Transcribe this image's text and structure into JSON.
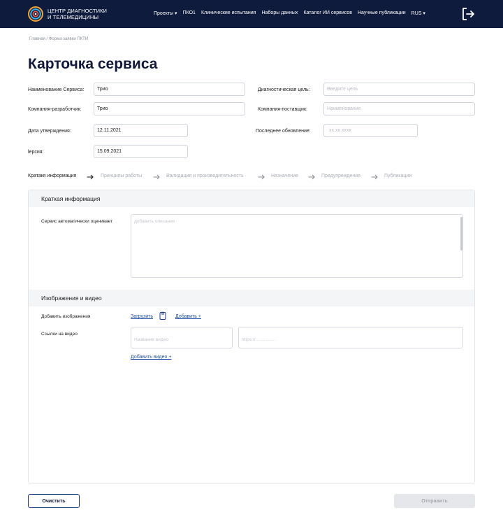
{
  "header": {
    "brand_line1": "ЦЕНТР ДИАГНОСТИКИ",
    "brand_line2": "И ТЕЛЕМЕДИЦИНЫ",
    "nav": [
      "Проекты ▾",
      "ПКО1",
      "Клинические испытания",
      "Наборы данных",
      "Каталог ИИ сервисов",
      "Научные публикации",
      "RUS ▾"
    ],
    "logo_icon": "logo-rings-icon",
    "logout_icon": "logout-icon"
  },
  "breadcrumb": "Главная / Форма заявки ПКТИ",
  "title": "Карточка сервиса",
  "form": {
    "service_name_label": "Наименование Сервиса:",
    "service_name_value": "Трио",
    "diag_goal_label": "Диагностическая цель:",
    "diag_goal_placeholder": "Введите цель",
    "developer_label": "Компания-разработчик:",
    "developer_value": "Трио",
    "supplier_label": "Компания-поставщик:",
    "supplier_placeholder": "Наименование",
    "approval_date_label": "Дата утверждения:",
    "approval_date_value": "12.11.2021",
    "last_update_label": "Последнее обновление:",
    "last_update_placeholder": "xx.xx.xxxx",
    "version_label": "lерсия:",
    "version_value": "15.09.2021"
  },
  "steps": [
    "Кратакя информация",
    "Принципы работы",
    "Валидация и производительность",
    "Назначение",
    "Предупреждения",
    "Публикации"
  ],
  "panel": {
    "brief_title": "Краткая информация",
    "auto_eval_label": "Сервис автоматически оценивает",
    "auto_eval_placeholder": "добавить описание",
    "media_title": "Изображения и видео",
    "add_images_label": "Добавить изображения",
    "upload_link": "Загрузить",
    "add_link": "Добавить +",
    "video_links_label": "Ссылки на видео",
    "video_name_placeholder": "Название видео",
    "video_url_placeholder": "https://................",
    "add_video_link": "Добавить видео +"
  },
  "buttons": {
    "clear": "Очистить",
    "send": "Отправить"
  },
  "colors": {
    "header_bg": "#0f1b3d",
    "accent": "#1f4fa8",
    "disabled_bg": "#e6e7ea"
  }
}
